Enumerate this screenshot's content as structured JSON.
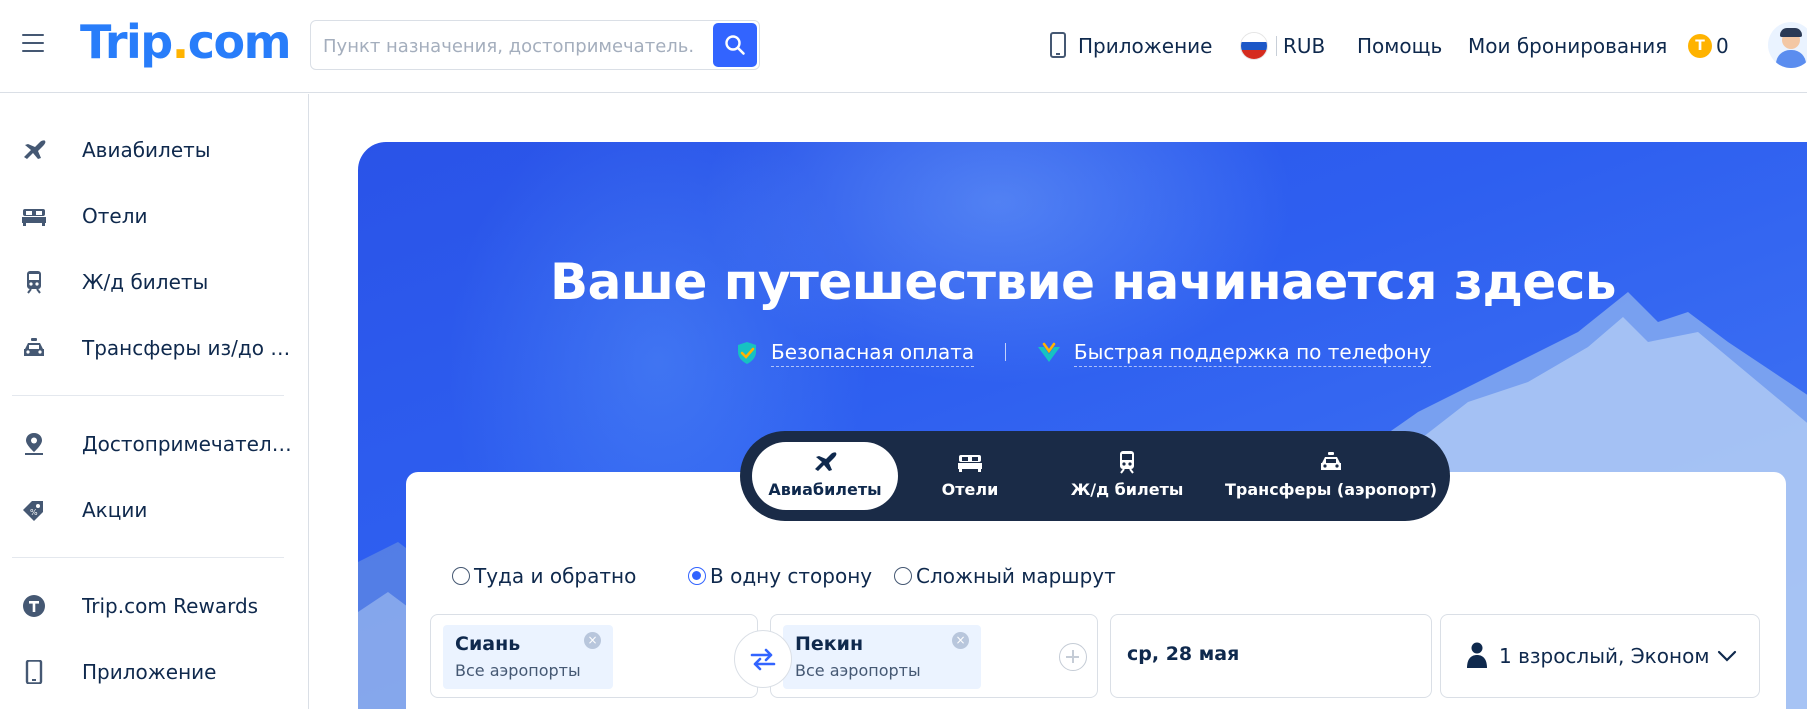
{
  "header": {
    "logo_main": "Trip",
    "logo_dot": ".",
    "logo_tail": "com",
    "search_placeholder": "Пункт назначения, достопримечатель...",
    "app": "Приложение",
    "currency": "RUB",
    "help": "Помощь",
    "bookings": "Мои бронирования",
    "coin_letter": "T",
    "coins": "0"
  },
  "sidebar": {
    "items": [
      {
        "label": "Авиабилеты",
        "icon": "plane-icon"
      },
      {
        "label": "Отели",
        "icon": "bed-icon"
      },
      {
        "label": "Ж/д билеты",
        "icon": "train-icon"
      },
      {
        "label": "Трансферы из/до аэропорта",
        "icon": "car-icon"
      },
      {
        "label": "Достопримечательности",
        "icon": "map-pin-icon"
      },
      {
        "label": "Акции",
        "icon": "tag-icon"
      },
      {
        "label": "Trip.com Rewards",
        "icon": "rewards-icon"
      },
      {
        "label": "Приложение",
        "icon": "phone-icon"
      }
    ]
  },
  "hero": {
    "title": "Ваше путешествие начинается здесь",
    "badge_1": "Безопасная оплата",
    "badge_2": "Быстрая поддержка по телефону"
  },
  "tabs": [
    {
      "label": "Авиабилеты",
      "active": true
    },
    {
      "label": "Отели",
      "active": false
    },
    {
      "label": "Ж/д билеты",
      "active": false
    },
    {
      "label": "Трансферы (аэропорт)",
      "active": false
    }
  ],
  "booking": {
    "trip_types": [
      {
        "label": "Туда и обратно",
        "checked": false
      },
      {
        "label": "В одну сторону",
        "checked": true
      },
      {
        "label": "Сложный маршрут",
        "checked": false
      }
    ],
    "from_city": "Сиань",
    "from_sub": "Все аэропорты",
    "to_city": "Пекин",
    "to_sub": "Все аэропорты",
    "date": "ср, 28 мая",
    "passengers": "1 взрослый, Эконом",
    "chip_close": "×"
  },
  "colors": {
    "brand": "#287dfa",
    "accent": "#3264ff",
    "logo_dot": "#ffb300",
    "text": "#0f294d"
  }
}
